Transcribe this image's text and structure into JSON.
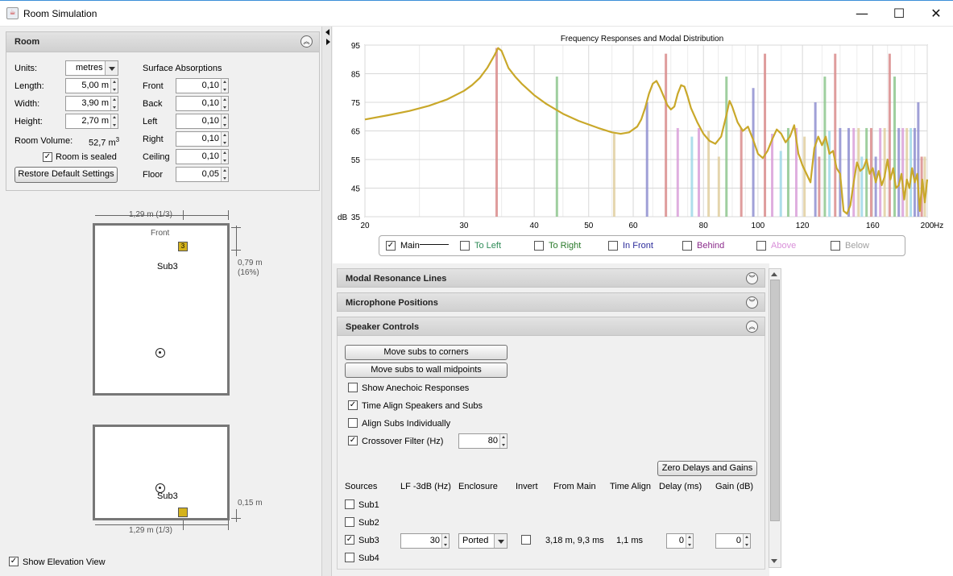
{
  "window": {
    "title": "Room Simulation",
    "minimize": "—",
    "maximize": "☐",
    "close": "✕"
  },
  "room": {
    "header": "Room",
    "units_label": "Units:",
    "units_value": "metres",
    "length_label": "Length:",
    "length_value": "5,00 m",
    "width_label": "Width:",
    "width_value": "3,90 m",
    "height_label": "Height:",
    "height_value": "2,70 m",
    "volume_label": "Room Volume:",
    "volume_value": "52,7 m",
    "volume_sup": "3",
    "sealed_label": "Room is sealed",
    "sealed_checked": true,
    "restore_button": "Restore Default Settings",
    "absorptions_title": "Surface Absorptions",
    "absorptions": [
      {
        "label": "Front",
        "value": "0,10"
      },
      {
        "label": "Back",
        "value": "0,10"
      },
      {
        "label": "Left",
        "value": "0,10"
      },
      {
        "label": "Right",
        "value": "0,10"
      },
      {
        "label": "Ceiling",
        "value": "0,10"
      },
      {
        "label": "Floor",
        "value": "0,05"
      }
    ]
  },
  "plan_view": {
    "front_label": "Front",
    "sub_label": "Sub3",
    "sub_badge": "3",
    "x_dim": "1,29 m (1/3)",
    "y_dim": "0,79 m",
    "y_dim_pct": "(16%)"
  },
  "elevation_view": {
    "sub_label": "Sub3",
    "x_dim": "1,29 m (1/3)",
    "z_dim": "0,15 m",
    "show_label": "Show Elevation View",
    "show_checked": true
  },
  "chart_data": {
    "type": "line",
    "title": "Frequency Responses and Modal Distribution",
    "xlabel": "",
    "ylabel": "dB",
    "xscale": "log",
    "xlim": [
      20,
      200
    ],
    "ylim": [
      35,
      95
    ],
    "xticks": [
      20,
      30,
      40,
      50,
      60,
      80,
      100,
      120,
      160,
      200
    ],
    "x_unit": "Hz",
    "yticks": [
      35,
      45,
      55,
      65,
      75,
      85,
      95
    ],
    "grid": true,
    "series": [
      {
        "name": "Main",
        "color": "#c9a82a",
        "x": [
          20,
          22,
          24,
          26,
          28,
          30,
          31,
          32,
          33,
          34,
          34.5,
          35,
          36,
          37,
          38,
          40,
          42,
          45,
          48,
          52,
          55,
          57,
          59,
          61,
          62,
          63,
          64,
          65,
          66,
          67,
          68,
          69,
          70,
          71,
          72,
          73,
          74,
          75,
          76,
          78,
          80,
          82,
          84,
          86,
          88,
          89,
          90,
          92,
          94,
          96,
          98,
          100,
          102,
          104,
          106,
          108,
          110,
          112,
          114,
          116,
          118,
          120,
          124,
          126,
          128,
          130,
          132,
          134,
          136,
          138,
          140,
          142,
          144,
          146,
          148,
          150,
          152,
          154,
          156,
          158,
          160,
          162,
          164,
          166,
          168,
          170,
          172,
          174,
          176,
          178,
          180,
          182,
          184,
          186,
          188,
          190,
          192,
          194,
          196,
          198,
          200
        ],
        "y": [
          69,
          70.5,
          72,
          73.8,
          76,
          79,
          81,
          83.5,
          87,
          91.5,
          94,
          93,
          87,
          84,
          81.5,
          77.5,
          74.5,
          71,
          68.5,
          66,
          64.5,
          64,
          64.5,
          66.5,
          69,
          73,
          78,
          81.5,
          82.5,
          80,
          77,
          74,
          72.5,
          73.5,
          78,
          81,
          80.5,
          77,
          73,
          68,
          64,
          61.5,
          60.5,
          63,
          71,
          75.5,
          73.5,
          68,
          65,
          66.5,
          62,
          57,
          55.5,
          58,
          62,
          65.5,
          64,
          61,
          63,
          67,
          57,
          53,
          47,
          59,
          63,
          60,
          63,
          57,
          58,
          52,
          50,
          37,
          36,
          39,
          47,
          54,
          51,
          52,
          55,
          50,
          52,
          47,
          51,
          46,
          49,
          55,
          48,
          52,
          45,
          46,
          50,
          41,
          48,
          45,
          52,
          47,
          50,
          37,
          48,
          40,
          48
        ]
      }
    ],
    "modal_lines": [
      {
        "f": 34.3,
        "level": 94,
        "color": "#d98c8c"
      },
      {
        "f": 43.9,
        "level": 84,
        "color": "#8ec78e"
      },
      {
        "f": 55.5,
        "level": 64,
        "color": "#e0cfa0"
      },
      {
        "f": 63.5,
        "level": 75,
        "color": "#8f8fd0"
      },
      {
        "f": 68.6,
        "level": 92,
        "color": "#d98c8c"
      },
      {
        "f": 72.0,
        "level": 66,
        "color": "#d9a0d9"
      },
      {
        "f": 76.3,
        "level": 63,
        "color": "#a0d8e8"
      },
      {
        "f": 78.5,
        "level": 66,
        "color": "#d9a0d9"
      },
      {
        "f": 81.7,
        "level": 65,
        "color": "#e0cfa0"
      },
      {
        "f": 85.2,
        "level": 56,
        "color": "#e0cfa0"
      },
      {
        "f": 87.9,
        "level": 84,
        "color": "#8ec78e"
      },
      {
        "f": 93.4,
        "level": 66,
        "color": "#d98c8c"
      },
      {
        "f": 98.1,
        "level": 80,
        "color": "#8f8fd0"
      },
      {
        "f": 102.9,
        "level": 92,
        "color": "#d98c8c"
      },
      {
        "f": 106.0,
        "level": 64,
        "color": "#d9a0d9"
      },
      {
        "f": 109.8,
        "level": 58,
        "color": "#a0d8e8"
      },
      {
        "f": 113.2,
        "level": 66,
        "color": "#8ec78e"
      },
      {
        "f": 117.0,
        "level": 66,
        "color": "#d9a0d9"
      },
      {
        "f": 121.0,
        "level": 63,
        "color": "#e0cfa0"
      },
      {
        "f": 126.5,
        "level": 75,
        "color": "#8f8fd0"
      },
      {
        "f": 128.5,
        "level": 56,
        "color": "#d98c8c"
      },
      {
        "f": 131.5,
        "level": 84,
        "color": "#8ec78e"
      },
      {
        "f": 134.0,
        "level": 65,
        "color": "#a0d8e8"
      },
      {
        "f": 137.2,
        "level": 92,
        "color": "#d98c8c"
      },
      {
        "f": 140.0,
        "level": 66,
        "color": "#8f8fd0"
      },
      {
        "f": 145.0,
        "level": 66,
        "color": "#8f8fd0"
      },
      {
        "f": 148.0,
        "level": 66,
        "color": "#d9a0d9"
      },
      {
        "f": 151.0,
        "level": 66,
        "color": "#e0cfa0"
      },
      {
        "f": 153.0,
        "level": 56,
        "color": "#a0d8e8"
      },
      {
        "f": 156.0,
        "level": 66,
        "color": "#8ec78e"
      },
      {
        "f": 159.0,
        "level": 66,
        "color": "#d98c8c"
      },
      {
        "f": 162.0,
        "level": 56,
        "color": "#8f8fd0"
      },
      {
        "f": 165.0,
        "level": 66,
        "color": "#d9a0d9"
      },
      {
        "f": 168.0,
        "level": 66,
        "color": "#e0cfa0"
      },
      {
        "f": 171.5,
        "level": 92,
        "color": "#d98c8c"
      },
      {
        "f": 175.0,
        "level": 84,
        "color": "#8ec78e"
      },
      {
        "f": 178.0,
        "level": 66,
        "color": "#8f8fd0"
      },
      {
        "f": 181.0,
        "level": 66,
        "color": "#d9a0d9"
      },
      {
        "f": 184.0,
        "level": 66,
        "color": "#e0cfa0"
      },
      {
        "f": 187.0,
        "level": 66,
        "color": "#a0d8e8"
      },
      {
        "f": 190.0,
        "level": 66,
        "color": "#8f8fd0"
      },
      {
        "f": 192.8,
        "level": 75,
        "color": "#8f8fd0"
      },
      {
        "f": 195.5,
        "level": 56,
        "color": "#d98c8c"
      },
      {
        "f": 198.0,
        "level": 56,
        "color": "#e0cfa0"
      }
    ]
  },
  "legend": [
    {
      "label": "Main",
      "color": "#000000",
      "checked": true
    },
    {
      "label": "To Left",
      "color": "#2e8b57",
      "checked": false
    },
    {
      "label": "To Right",
      "color": "#2a7a2a",
      "checked": false
    },
    {
      "label": "In Front",
      "color": "#2b2b9b",
      "checked": false
    },
    {
      "label": "Behind",
      "color": "#8b2b8b",
      "checked": false
    },
    {
      "label": "Above",
      "color": "#d98fd9",
      "checked": false
    },
    {
      "label": "Below",
      "color": "#a0a0a0",
      "checked": false
    }
  ],
  "sections": {
    "modal": "Modal Resonance Lines",
    "mics": "Microphone Positions",
    "speakers": "Speaker Controls"
  },
  "speaker": {
    "corners_button": "Move subs to corners",
    "midpoints_button": "Move subs to wall midpoints",
    "anechoic_label": "Show Anechoic Responses",
    "anechoic_checked": false,
    "time_align_label": "Time Align Speakers and Subs",
    "time_align_checked": true,
    "align_individually_label": "Align Subs Individually",
    "align_individually_checked": false,
    "crossover_label": "Crossover Filter (Hz)",
    "crossover_checked": true,
    "crossover_value": "80",
    "zero_button": "Zero Delays and Gains",
    "columns": [
      "Sources",
      "LF -3dB (Hz)",
      "Enclosure",
      "Invert",
      "From Main",
      "Time Align",
      "Delay (ms)",
      "Gain (dB)"
    ],
    "rows": [
      {
        "name": "Sub1",
        "checked": false
      },
      {
        "name": "Sub2",
        "checked": false
      },
      {
        "name": "Sub3",
        "checked": true,
        "lf": "30",
        "enclosure": "Ported",
        "invert": false,
        "from_main": "3,18 m, 9,3 ms",
        "time_align": "1,1 ms",
        "delay": "0",
        "gain": "0"
      },
      {
        "name": "Sub4",
        "checked": false
      }
    ]
  }
}
